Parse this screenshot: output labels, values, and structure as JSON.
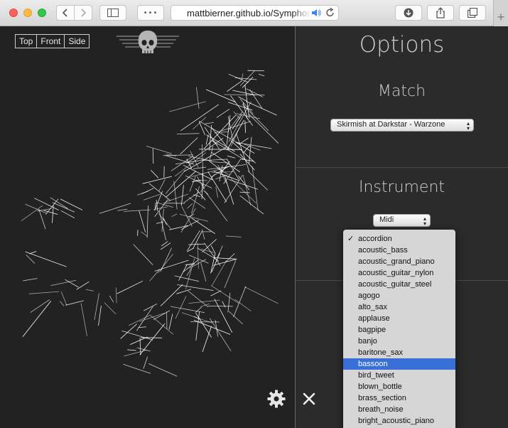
{
  "browser": {
    "url": "mattbierner.github.io/Symphony",
    "menu_glyph": "•••"
  },
  "viz": {
    "view_buttons": [
      "Top",
      "Front",
      "Side"
    ]
  },
  "options": {
    "title": "Options",
    "match": {
      "heading": "Match",
      "selected": "Skirmish at Darkstar - Warzone"
    },
    "instrument": {
      "heading": "Instrument",
      "selected": "Midi"
    }
  },
  "dropdown": {
    "items": [
      "accordion",
      "acoustic_bass",
      "acoustic_grand_piano",
      "acoustic_guitar_nylon",
      "acoustic_guitar_steel",
      "agogo",
      "alto_sax",
      "applause",
      "bagpipe",
      "banjo",
      "baritone_sax",
      "bassoon",
      "bird_tweet",
      "blown_bottle",
      "brass_section",
      "breath_noise",
      "bright_acoustic_piano"
    ],
    "checked": "accordion",
    "highlighted": "bassoon",
    "check_glyph": "✓"
  },
  "colors": {
    "background": "#222222",
    "panel": "#2b2b2b",
    "highlight": "#3b6fd8",
    "lines": "#ffffff"
  }
}
